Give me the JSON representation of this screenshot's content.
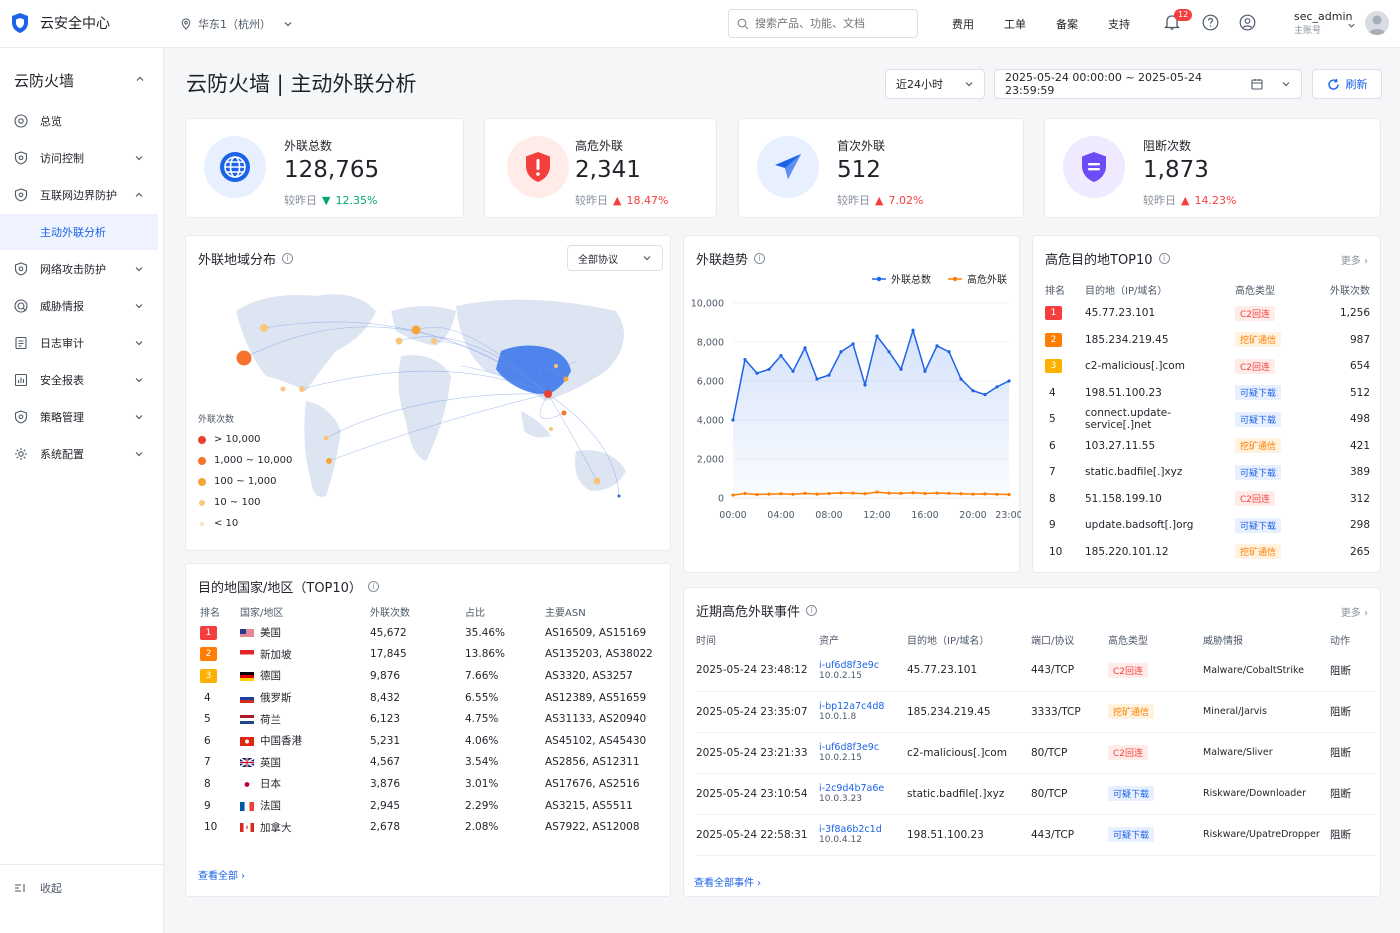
{
  "brand": {
    "title": "云安全中心"
  },
  "region": "华东1（杭州）",
  "search": {
    "placeholder": "搜索产品、功能、文档"
  },
  "topnav": [
    "费用",
    "工单",
    "备案",
    "支持"
  ],
  "notifications": {
    "count": "12"
  },
  "user": {
    "name": "sec_admin",
    "role": "主账号"
  },
  "sidebar": {
    "title": "云防火墙",
    "items": [
      {
        "label": "总览",
        "icon": "home-icon"
      },
      {
        "label": "访问控制",
        "icon": "shield-icon"
      },
      {
        "label": "互联网边界防护",
        "icon": "shield-icon"
      },
      {
        "label": "主动外联分析",
        "icon": ""
      },
      {
        "label": "网络攻击防护",
        "icon": "shield-icon"
      },
      {
        "label": "威胁情报",
        "icon": "target-icon"
      },
      {
        "label": "日志审计",
        "icon": "doc-icon"
      },
      {
        "label": "安全报表",
        "icon": "chart-icon"
      },
      {
        "label": "策略管理",
        "icon": "shield-icon"
      },
      {
        "label": "系统配置",
        "icon": "gear-icon"
      }
    ],
    "collapse": "收起"
  },
  "page": {
    "title": "云防火墙 | 主动外联分析",
    "time_range": "近24小时",
    "date_range": "2025-05-24 00:00:00 ~ 2025-05-24 23:59:59",
    "refresh": "刷新"
  },
  "stats": [
    {
      "label": "外联总数",
      "value": "128,765",
      "cmp_label": "较昨日",
      "dir": "down",
      "change": "12.35%",
      "color": "#1d63e8"
    },
    {
      "label": "高危外联",
      "value": "2,341",
      "cmp_label": "较昨日",
      "dir": "up",
      "change": "18.47%",
      "color": "#f53f3f"
    },
    {
      "label": "首次外联",
      "value": "512",
      "cmp_label": "较昨日",
      "dir": "up",
      "change": "7.02%",
      "color": "#1d63e8"
    },
    {
      "label": "阻断次数",
      "value": "1,873",
      "cmp_label": "较昨日",
      "dir": "up",
      "change": "14.23%",
      "color": "#6d4cf5"
    }
  ],
  "geo": {
    "title": "外联地域分布",
    "protocol": "全部协议",
    "legend_title": "外联次数",
    "legend": [
      {
        "label": "> 10,000",
        "color": "#e8432e"
      },
      {
        "label": "1,000 ~ 10,000",
        "color": "#f5732e"
      },
      {
        "label": "100 ~ 1,000",
        "color": "#f7a33c"
      },
      {
        "label": "10 ~ 100",
        "color": "#f9c57a"
      },
      {
        "label": "< 10",
        "color": "#fbe2bd"
      }
    ]
  },
  "trend": {
    "title": "外联趋势",
    "legend": [
      "外联总数",
      "高危外联"
    ]
  },
  "chart_data": {
    "type": "line",
    "x": [
      "00:00",
      "01:00",
      "02:00",
      "03:00",
      "04:00",
      "05:00",
      "06:00",
      "07:00",
      "08:00",
      "09:00",
      "10:00",
      "11:00",
      "12:00",
      "13:00",
      "14:00",
      "15:00",
      "16:00",
      "17:00",
      "18:00",
      "19:00",
      "20:00",
      "21:00",
      "22:00",
      "23:00"
    ],
    "xticks": [
      "00:00",
      "04:00",
      "08:00",
      "12:00",
      "16:00",
      "20:00",
      "23:00"
    ],
    "yticks": [
      "10,000",
      "8,000",
      "6,000",
      "4,000",
      "2,000",
      "0"
    ],
    "ylim": [
      0,
      10000
    ],
    "series": [
      {
        "name": "外联总数",
        "color": "#1d63e8",
        "values": [
          4000,
          7100,
          6400,
          6600,
          7300,
          6500,
          7700,
          6100,
          6300,
          7500,
          7900,
          5800,
          8300,
          7500,
          6600,
          8600,
          6500,
          7800,
          7500,
          6100,
          5500,
          5300,
          5700,
          6000
        ]
      },
      {
        "name": "高危外联",
        "color": "#ff7d00",
        "values": [
          150,
          230,
          180,
          200,
          220,
          190,
          240,
          200,
          230,
          260,
          250,
          220,
          300,
          250,
          240,
          270,
          230,
          250,
          240,
          220,
          200,
          210,
          190,
          180
        ]
      }
    ]
  },
  "top10": {
    "title": "高危目的地TOP10",
    "more": "更多",
    "headers": [
      "排名",
      "目的地（IP/域名）",
      "高危类型",
      "外联次数"
    ],
    "rows": [
      {
        "rank": "1",
        "dest": "45.77.23.101",
        "type": "C2回连",
        "tag": "c2",
        "count": "1,256"
      },
      {
        "rank": "2",
        "dest": "185.234.219.45",
        "type": "挖矿通信",
        "tag": "mine",
        "count": "987"
      },
      {
        "rank": "3",
        "dest": "c2-malicious[.]com",
        "type": "C2回连",
        "tag": "c2",
        "count": "654"
      },
      {
        "rank": "4",
        "dest": "198.51.100.23",
        "type": "可疑下载",
        "tag": "dl",
        "count": "512"
      },
      {
        "rank": "5",
        "dest": "connect.update-service[.]net",
        "type": "可疑下载",
        "tag": "dl",
        "count": "498"
      },
      {
        "rank": "6",
        "dest": "103.27.11.55",
        "type": "挖矿通信",
        "tag": "mine",
        "count": "421"
      },
      {
        "rank": "7",
        "dest": "static.badfile[.]xyz",
        "type": "可疑下载",
        "tag": "dl",
        "count": "389"
      },
      {
        "rank": "8",
        "dest": "51.158.199.10",
        "type": "C2回连",
        "tag": "c2",
        "count": "312"
      },
      {
        "rank": "9",
        "dest": "update.badsoft[.]org",
        "type": "可疑下载",
        "tag": "dl",
        "count": "298"
      },
      {
        "rank": "10",
        "dest": "185.220.101.12",
        "type": "挖矿通信",
        "tag": "mine",
        "count": "265"
      }
    ]
  },
  "countries": {
    "title": "目的地国家/地区（TOP10）",
    "headers": [
      "排名",
      "国家/地区",
      "外联次数",
      "占比",
      "主要ASN"
    ],
    "rows": [
      {
        "rank": "1",
        "name": "美国",
        "flag": "us",
        "count": "45,672",
        "pct": "35.46%",
        "asn": "AS16509, AS15169"
      },
      {
        "rank": "2",
        "name": "新加坡",
        "flag": "sg",
        "count": "17,845",
        "pct": "13.86%",
        "asn": "AS135203, AS38022"
      },
      {
        "rank": "3",
        "name": "德国",
        "flag": "de",
        "count": "9,876",
        "pct": "7.66%",
        "asn": "AS3320, AS3257"
      },
      {
        "rank": "4",
        "name": "俄罗斯",
        "flag": "ru",
        "count": "8,432",
        "pct": "6.55%",
        "asn": "AS12389, AS51659"
      },
      {
        "rank": "5",
        "name": "荷兰",
        "flag": "nl",
        "count": "6,123",
        "pct": "4.75%",
        "asn": "AS31133, AS20940"
      },
      {
        "rank": "6",
        "name": "中国香港",
        "flag": "hk",
        "count": "5,231",
        "pct": "4.06%",
        "asn": "AS45102, AS45430"
      },
      {
        "rank": "7",
        "name": "英国",
        "flag": "gb",
        "count": "4,567",
        "pct": "3.54%",
        "asn": "AS2856, AS12311"
      },
      {
        "rank": "8",
        "name": "日本",
        "flag": "jp",
        "count": "3,876",
        "pct": "3.01%",
        "asn": "AS17676, AS2516"
      },
      {
        "rank": "9",
        "name": "法国",
        "flag": "fr",
        "count": "2,945",
        "pct": "2.29%",
        "asn": "AS3215, AS5511"
      },
      {
        "rank": "10",
        "name": "加拿大",
        "flag": "ca",
        "count": "2,678",
        "pct": "2.08%",
        "asn": "AS7922, AS12008"
      }
    ],
    "view_all": "查看全部"
  },
  "events": {
    "title": "近期高危外联事件",
    "more": "更多",
    "headers": [
      "时间",
      "资产",
      "目的地（IP/域名）",
      "端口/协议",
      "高危类型",
      "威胁情报",
      "动作"
    ],
    "rows": [
      {
        "time": "2025-05-24 23:48:12",
        "asset": "i-uf6d8f3e9c",
        "ip": "10.0.2.15",
        "dest": "45.77.23.101",
        "port": "443/TCP",
        "type": "C2回连",
        "tag": "c2",
        "intel": "Malware/CobaltStrike",
        "action": "阻断"
      },
      {
        "time": "2025-05-24 23:35:07",
        "asset": "i-bp12a7c4d8",
        "ip": "10.0.1.8",
        "dest": "185.234.219.45",
        "port": "3333/TCP",
        "type": "挖矿通信",
        "tag": "mine",
        "intel": "Mineral/Jarvis",
        "action": "阻断"
      },
      {
        "time": "2025-05-24 23:21:33",
        "asset": "i-uf6d8f3e9c",
        "ip": "10.0.2.15",
        "dest": "c2-malicious[.]com",
        "port": "80/TCP",
        "type": "C2回连",
        "tag": "c2",
        "intel": "Malware/Sliver",
        "action": "阻断"
      },
      {
        "time": "2025-05-24 23:10:54",
        "asset": "i-2c9d4b7a6e",
        "ip": "10.0.3.23",
        "dest": "static.badfile[.]xyz",
        "port": "80/TCP",
        "type": "可疑下载",
        "tag": "dl",
        "intel": "Riskware/Downloader",
        "action": "阻断"
      },
      {
        "time": "2025-05-24 22:58:31",
        "asset": "i-3f8a6b2c1d",
        "ip": "10.0.4.12",
        "dest": "198.51.100.23",
        "port": "443/TCP",
        "type": "可疑下载",
        "tag": "dl",
        "intel": "Riskware/UpatreDropper",
        "action": "阻断"
      }
    ],
    "view_all": "查看全部事件"
  }
}
